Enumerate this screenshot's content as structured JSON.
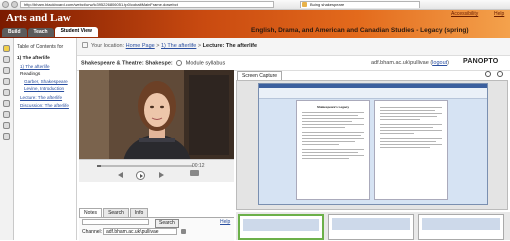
{
  "browser": {
    "url": "http://bham.blackboard.com/webct/urw/lc395226806051.tp0/cobaltMainFrame.dowebct",
    "tab_title": "Buing shakespeare"
  },
  "site": {
    "title": "Arts and Law",
    "accessibility": "Accessibility",
    "help": "Help",
    "tabs": [
      {
        "label": "Build"
      },
      {
        "label": "Teach"
      },
      {
        "label": "Student View"
      }
    ],
    "course_title": "English, Drama, and American and Canadian Studies - Legacy (spring)"
  },
  "toc": {
    "heading": "Table of Contents for",
    "section": "1) The afterlife",
    "items": [
      {
        "label": "1) The afterlife",
        "link": true,
        "indent": 1
      },
      {
        "label": "Readings",
        "link": false,
        "indent": 1
      },
      {
        "label": "Garber, Shakespeare",
        "link": true,
        "indent": 2
      },
      {
        "label": "Levine, Introduction",
        "link": true,
        "indent": 2
      },
      {
        "label": "Lecture: The afterlife",
        "link": true,
        "indent": 1
      },
      {
        "label": "Discussion: The afterlife",
        "link": true,
        "indent": 1
      }
    ]
  },
  "breadcrumb": {
    "prefix": "Your location:",
    "home": "Home Page",
    "section": "1) The afterlife",
    "current": "Lecture: The afterlife"
  },
  "panopto": {
    "course": "Shakespeare & Theatre: Shakespe:",
    "module": "Module syllabus",
    "user": "adf.bham.ac.uk\\pullivae",
    "logout": "logout",
    "logo": "PANOPTO"
  },
  "player": {
    "time": "00:12",
    "progress": 0.04
  },
  "notes": {
    "tabs": [
      {
        "label": "Notes"
      },
      {
        "label": "Search"
      },
      {
        "label": "Info"
      }
    ],
    "search_button": "Search",
    "help": "Help",
    "channel_label": "Channel:",
    "channel_value": "adf.bham.ac.uk\\pullivae"
  },
  "screen_capture": {
    "tab": "Screen Capture",
    "doc_heading": "Shakespeare's Legacy"
  },
  "colors": {
    "header_dark": "#7a1a00",
    "header_light": "#f4a24c",
    "link": "#2a4fa0",
    "thumb_selected": "#6cb04a"
  }
}
